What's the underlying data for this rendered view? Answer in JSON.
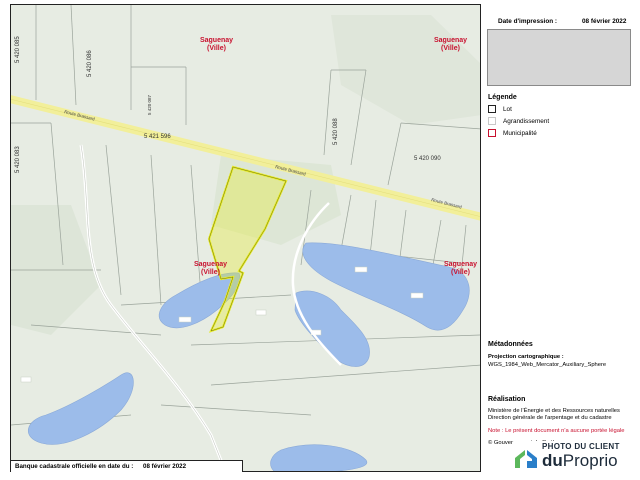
{
  "map": {
    "labels": {
      "saguenay_nw": "Saguenay\n(Ville)",
      "saguenay_ne": "Saguenay\n(Ville)",
      "saguenay_center": "Saguenay\n(Ville)",
      "saguenay_east": "Saguenay\n(Ville)"
    },
    "roads": {
      "route_brassard_1": "Route Brassard",
      "route_brassard_2": "Route Brassard",
      "route_brassard_3": "Route Brassard"
    },
    "lots": {
      "lot_085": "5 420 085",
      "lot_086": "5 420 086",
      "lot_087": "5 420 087",
      "lot_596": "5 421 596",
      "lot_088": "5 420 088",
      "lot_090": "5 420 090",
      "lot_083": "5 420 083"
    },
    "colors": {
      "background": "#e7ece3",
      "water": "#9cbcea",
      "road": "#f2ef9a",
      "selection": "#e6ec2a",
      "lot_line": "#9aa39a"
    }
  },
  "scale_bar": {
    "label": "Banque cadastrale officielle en date du :",
    "date": "08 février 2022"
  },
  "panel": {
    "print_date_label": "Date d'impression :",
    "print_date_value": "08 février 2022",
    "legend": {
      "title": "Légende",
      "items": [
        {
          "label": "Lot"
        },
        {
          "label": "Agrandissement"
        },
        {
          "label": "Municipalité"
        }
      ]
    },
    "metadata": {
      "title": "Métadonnées",
      "projection_label": "Projection cartographique :",
      "projection_value": "WGS_1984_Web_Mercator_Auxiliary_Sphere"
    },
    "realisation": {
      "title": "Réalisation",
      "line1": "Ministère de l'Énergie et des Ressources naturelles",
      "line2": "Direction générale de l'arpentage et du cadastre"
    },
    "note": "Note : Le présent document n'a aucune portée légale",
    "copyright": "© Gouvernement du Québec"
  },
  "badge": {
    "top": "PHOTO DU CLIENT",
    "brand_bold": "du",
    "brand_rest": "Proprio",
    "colors": {
      "green": "#5cb85c",
      "blue": "#2a7fc9",
      "navy": "#1d2b3a"
    }
  }
}
